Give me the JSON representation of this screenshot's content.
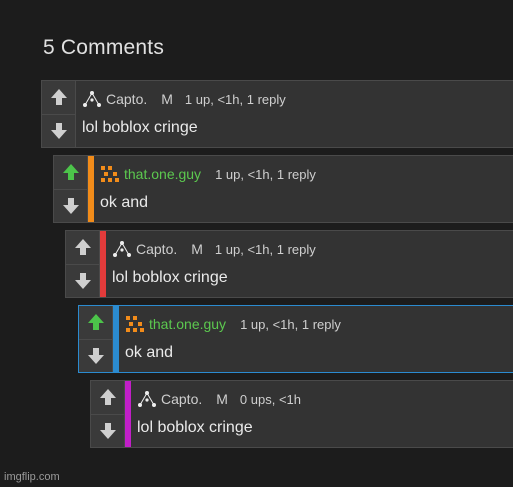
{
  "header": {
    "title": "5 Comments"
  },
  "comments": [
    {
      "username": "Capto.",
      "badge": "M",
      "stats": "1 up, <1h, 1 reply",
      "text": "lol boblox cringe",
      "upvoted": false,
      "stripe_color": "",
      "avatar_icon": "triangle-dots-icon"
    },
    {
      "username": "that.one.guy",
      "badge": "",
      "stats": "1 up, <1h, 1 reply",
      "text": "ok and",
      "upvoted": true,
      "stripe_color": "#f28c1a",
      "avatar_icon": "orange-grid-icon"
    },
    {
      "username": "Capto.",
      "badge": "M",
      "stats": "1 up, <1h, 1 reply",
      "text": "lol boblox cringe",
      "upvoted": false,
      "stripe_color": "#e23b3b",
      "avatar_icon": "triangle-dots-icon"
    },
    {
      "username": "that.one.guy",
      "badge": "",
      "stats": "1 up, <1h, 1 reply",
      "text": "ok and",
      "upvoted": true,
      "stripe_color": "#2b8bd0",
      "avatar_icon": "orange-grid-icon"
    },
    {
      "username": "Capto.",
      "badge": "M",
      "stats": "0 ups, <1h",
      "text": "lol boblox cringe",
      "upvoted": false,
      "stripe_color": "#c21fc8",
      "avatar_icon": "triangle-dots-icon"
    }
  ],
  "colors": {
    "upvote_active": "#4cc44a",
    "vote_inactive": "#cfcfcf"
  },
  "footer": {
    "watermark": "imgflip.com"
  }
}
